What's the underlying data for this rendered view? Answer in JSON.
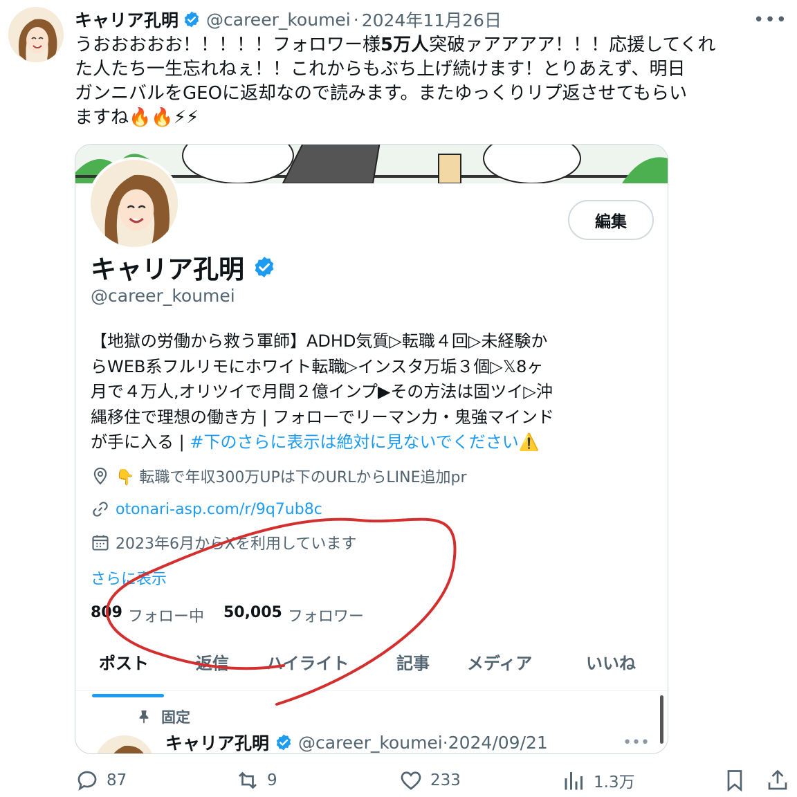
{
  "tweet": {
    "name": "キャリア孔明",
    "handle": "@career_koumei",
    "separator": "·",
    "date": "2024年11月26日",
    "more": "•••",
    "text_lines": [
      [
        "うおおおおお！！！！！フォロワー様",
        "5万人",
        "突破ァアアアア！！！応援してくれ"
      ],
      [
        "た人たち一生忘れねぇ！！これからもぶち上げ続けます！とりあえず、明日"
      ],
      [
        "ガンニバルをGEOに返却なので読みます。またゆっくりリプ返させてもらい"
      ],
      [
        "ますね",
        "🔥🔥⚡⚡"
      ]
    ]
  },
  "profile": {
    "edit_label": "編集",
    "name": "キャリア孔明",
    "handle": "@career_koumei",
    "bio_lines": [
      "【地獄の労働から救う軍師】ADHD気質▷転職４回▷未経験か",
      "らWEB系フルリモにホワイト転職▷インスタ万垢３個▷𝕏8ヶ",
      "月で４万人,オリツイで月間２億インプ▶その方法は固ツイ▷沖",
      "縄移住で理想の働き方 | フォローでリーマン力・鬼強マインド"
    ],
    "bio_last_prefix": "が手に入る | ",
    "bio_hashtag": "#下のさらに表示は絶対に見ないでください",
    "bio_last_emoji": "⚠️",
    "location": "👇 転職で年収300万UPは下のURLからLINE追加pr",
    "url": "otonari-asp.com/r/9q7ub8c",
    "joined": "2023年6月からXを利用しています",
    "show_more": "さらに表示",
    "following_count": "809",
    "following_label": "フォロー中",
    "followers_count": "50,005",
    "followers_label": "フォロワー",
    "tabs": [
      "ポスト",
      "返信",
      "ハイライト",
      "記事",
      "メディア",
      "いいね"
    ],
    "pinned_label": "固定",
    "pinned_name": "キャリア孔明",
    "pinned_handle": "@career_koumei",
    "pinned_date": "·2024/09/21",
    "pinned_more": "•••"
  },
  "actions": {
    "replies": "87",
    "reposts": "9",
    "likes": "233",
    "views": "1.3万"
  },
  "colors": {
    "accent": "#1d9bf0",
    "annotation": "#d32f2f",
    "muted": "#536471"
  }
}
